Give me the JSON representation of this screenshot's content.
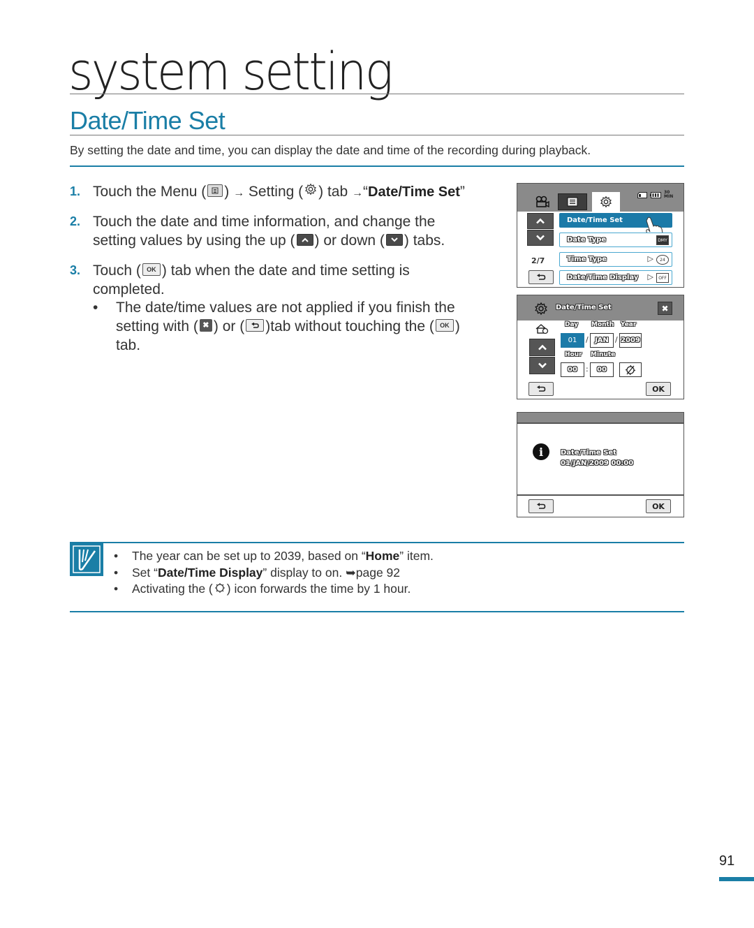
{
  "header": {
    "chapter_title": "system setting",
    "section_title": "Date/Time Set",
    "intro": "By setting the date and time, you can display the date and time of the recording during playback."
  },
  "steps": [
    {
      "number": "1.",
      "parts": {
        "a": "Touch the Menu (",
        "b": ") ",
        "arrow": "→",
        "c": " Setting (",
        "d": ") tab ",
        "e": "“",
        "bold": "Date/Time Set",
        "f": "”"
      }
    },
    {
      "number": "2.",
      "line1": "Touch the date and time information, and change the",
      "line2a": "setting values by using the up (",
      "line2b": ") or down (",
      "line2c": ") tabs."
    },
    {
      "number": "3.",
      "line1a": "Touch (",
      "line1b": ") tab when the date and time setting is",
      "line2": "completed.",
      "bullet": {
        "dot": "•",
        "line1": "The date/time values are not applied if you finish the",
        "line2a": "setting with (",
        "line2b": ") or (",
        "line2c": ")tab without touching the (",
        "line2d": ")",
        "line3": "tab."
      }
    }
  ],
  "icons": {
    "ok_label": "OK",
    "close_glyph": "✖",
    "back_glyph": "⮌",
    "up_glyph": "˄",
    "down_glyph": "˅"
  },
  "screen1": {
    "status_remaining": "30 MIN",
    "page_indicator": "2/7",
    "menu_items": [
      {
        "label": "Date/Time Set",
        "active": true
      },
      {
        "label": "Date Type",
        "value_icon": "DMY"
      },
      {
        "label": "Time Type",
        "value_icon": "24"
      },
      {
        "label": "Date/Time Display",
        "value_icon": "OFF"
      }
    ],
    "arrow": "▷"
  },
  "screen2": {
    "title": "Date/Time Set",
    "labels": {
      "day": "Day",
      "month": "Month",
      "year": "Year",
      "hour": "Hour",
      "minute": "Minute"
    },
    "values": {
      "day": "01",
      "month": "JAN",
      "year": "2009",
      "hour": "00",
      "minute": "00"
    },
    "date_sep": "/",
    "time_sep": ":",
    "ok_label": "OK"
  },
  "screen3": {
    "info_glyph": "i",
    "message_line1": "Date/Time Set",
    "message_line2": "01/JAN/2009 00:00",
    "ok_label": "OK"
  },
  "note": {
    "items": [
      {
        "pre": "The year can be set up to 2039, based on “",
        "bold": "Home",
        "post": "” item."
      },
      {
        "pre": "Set “",
        "bold": "Date/Time Display",
        "post": "” display to on. ➥page 92"
      },
      {
        "pre": "Activating the (",
        "post": ") icon forwards the time by 1 hour."
      }
    ],
    "bullet": "•"
  },
  "footer": {
    "page_number": "91"
  },
  "colors": {
    "accent": "#1a7ea6",
    "lcd_bar": "#8a8a8a",
    "lcd_selected": "#1b7aa8"
  }
}
